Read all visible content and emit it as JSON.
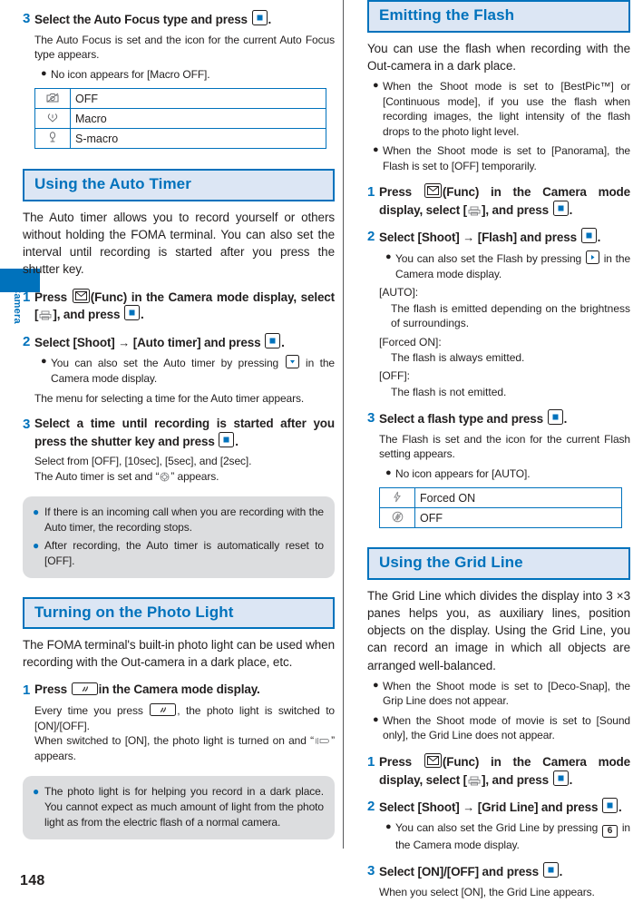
{
  "page": {
    "number": "148",
    "side_tab_label": "Camera"
  },
  "left_column": {
    "step3_autofocus": {
      "num": "3",
      "text_before": "Select the Auto Focus type and press",
      "key": "center-select-key",
      "text_after": ".",
      "body": "The Auto Focus is set and the icon for the current Auto Focus type appears.",
      "bullet": "No icon appears for [Macro OFF].",
      "table": {
        "rows": [
          {
            "icon": "macro-off-icon",
            "label": "OFF"
          },
          {
            "icon": "macro-icon",
            "label": "Macro"
          },
          {
            "icon": "s-macro-icon",
            "label": "S-macro"
          }
        ]
      }
    },
    "auto_timer": {
      "heading": "Using the Auto Timer",
      "intro": "The Auto timer allows you to record yourself or others without holding the FOMA terminal. You can also set the interval until recording is started after you press the shutter key.",
      "steps": [
        {
          "num": "1",
          "part1": "Press",
          "key1": "mail-func-key",
          "part2": "(Func) in the Camera mode display, select [",
          "key2": "shoot-menu-icon",
          "part3": "], and press",
          "key3": "center-select-key",
          "part4": "."
        },
        {
          "num": "2",
          "part1": "Select [Shoot]",
          "arrow": "→",
          "part2": "[Auto timer] and press",
          "key1": "center-select-key",
          "part3": ".",
          "bullet_pre": "You can also set the Auto timer by pressing",
          "bullet_key": "down-arrow-key",
          "bullet_post": "in the Camera mode display.",
          "body": "The menu for selecting a time for the Auto timer appears."
        },
        {
          "num": "3",
          "part1": "Select a time until recording is started after you press the shutter key and press",
          "key1": "center-select-key",
          "part2": ".",
          "body1": "Select from [OFF], [10sec], [5sec], and [2sec].",
          "body2_pre": "The Auto timer is set and “",
          "body2_icon": "auto-timer-icon",
          "body2_post": "” appears."
        }
      ],
      "notes": [
        "If there is an incoming call when you are recording with the Auto timer, the recording stops.",
        "After recording, the Auto timer is automatically reset to [OFF]."
      ]
    },
    "photo_light": {
      "heading": "Turning on the Photo Light",
      "intro": "The FOMA terminal's built-in photo light can be used when recording with the Out-camera in a dark place, etc.",
      "step": {
        "num": "1",
        "part1": "Press",
        "key1": "photo-light-key",
        "part2": "in the Camera mode display."
      },
      "body_pre": "Every time you press",
      "body_key": "photo-light-key",
      "body_post": ", the photo light is switched to [ON]/[OFF].",
      "body2_pre": "When switched to [ON], the photo light is turned on and “",
      "body2_icon": "photo-light-icon",
      "body2_post": "” appears.",
      "note": "The photo light is for helping you record in a dark place. You cannot expect as much amount of light from the photo light as from the electric flash of a normal camera."
    }
  },
  "right_column": {
    "flash": {
      "heading": "Emitting the Flash",
      "intro": "You can use the flash when recording with the Out-camera in a dark place.",
      "bullets": [
        "When the Shoot mode is set to [BestPic™] or [Continuous mode], if you use the flash when recording images, the light intensity of the flash drops to the photo light level.",
        "When the Shoot mode is set to [Panorama], the Flash is set to [OFF] temporarily."
      ],
      "steps": [
        {
          "num": "1",
          "part1": "Press",
          "key1": "mail-func-key",
          "part2": "(Func) in the Camera mode display, select [",
          "key2": "shoot-menu-icon",
          "part3": "], and press",
          "key3": "center-select-key",
          "part4": "."
        },
        {
          "num": "2",
          "part1": "Select [Shoot]",
          "arrow": "→",
          "part2": "[Flash] and press",
          "key1": "center-select-key",
          "part3": ".",
          "bullet_pre": "You can also set the Flash by pressing",
          "bullet_key": "right-arrow-key",
          "bullet_post": "in the Camera mode display.",
          "definitions": [
            {
              "term": "[AUTO]:",
              "body": "The flash is emitted depending on the brightness of surroundings."
            },
            {
              "term": "[Forced ON]:",
              "body": "The flash is always emitted."
            },
            {
              "term": "[OFF]:",
              "body": "The flash is not emitted."
            }
          ]
        },
        {
          "num": "3",
          "part1": "Select a flash type and press",
          "key1": "center-select-key",
          "part2": ".",
          "body": "The Flash is set and the icon for the current Flash setting appears.",
          "bullet": "No icon appears for [AUTO].",
          "table": {
            "rows": [
              {
                "icon": "flash-forced-on-icon",
                "label": "Forced ON"
              },
              {
                "icon": "flash-off-icon",
                "label": "OFF"
              }
            ]
          }
        }
      ]
    },
    "grid_line": {
      "heading": "Using the Grid Line",
      "intro": "The Grid Line which divides the display into 3 ×3 panes helps you, as auxiliary lines, position objects on the display. Using the Grid Line, you can record an image in which all objects are arranged well-balanced.",
      "bullets": [
        "When the Shoot mode is set to [Deco-Snap], the Grip Line does not appear.",
        "When the Shoot mode of movie is set to [Sound only], the Grid Line does not appear."
      ],
      "steps": [
        {
          "num": "1",
          "part1": "Press",
          "key1": "mail-func-key",
          "part2": "(Func) in the Camera mode display, select [",
          "key2": "shoot-menu-icon",
          "part3": "], and press",
          "key3": "center-select-key",
          "part4": "."
        },
        {
          "num": "2",
          "part1": "Select [Shoot]",
          "arrow": "→",
          "part2": "[Grid Line] and press",
          "key1": "center-select-key",
          "part3": ".",
          "bullet_pre": "You can also set the Grid Line by pressing",
          "bullet_key": "numeric-key-6",
          "bullet_key_label": "6",
          "bullet_post": "in the Camera mode display."
        },
        {
          "num": "3",
          "part1": "Select [ON]/[OFF] and press",
          "key1": "center-select-key",
          "part2": ".",
          "body": "When you select [ON], the Grid Line appears."
        }
      ]
    }
  },
  "colors": {
    "accent_blue": "#0072bc",
    "header_bg": "#dce6f4",
    "note_bg": "#dcdddf",
    "text": "#221f1f"
  }
}
